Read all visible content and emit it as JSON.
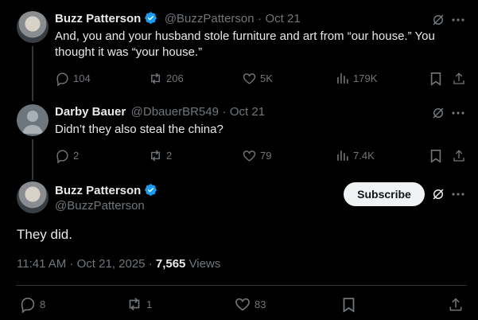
{
  "tweets": [
    {
      "name": "Buzz Patterson",
      "handle": "@BuzzPatterson",
      "sep": "·",
      "date": "Oct 21",
      "text": "And, you and your husband stole furniture and art from “our house.” You thought it was “your house.”",
      "replies": "104",
      "retweets": "206",
      "likes": "5K",
      "views": "179K"
    },
    {
      "name": "Darby Bauer",
      "handle": "@DbauerBR549",
      "sep": "·",
      "date": "Oct 21",
      "text": "Didn’t they also steal the china?",
      "replies": "2",
      "retweets": "2",
      "likes": "79",
      "views": "7.4K"
    }
  ],
  "main": {
    "name": "Buzz Patterson",
    "handle": "@BuzzPatterson",
    "subscribe_label": "Subscribe",
    "text": "They did.",
    "time": "11:41 AM",
    "sep1": "·",
    "date": "Oct 21, 2025",
    "sep2": "·",
    "views_count": "7,565",
    "views_label": "Views",
    "replies": "8",
    "retweets": "1",
    "likes": "83"
  },
  "colors": {
    "background": "#000000",
    "text": "#e7e9ea",
    "muted": "#71767b",
    "verified": "#1d9bf0",
    "subscribe_bg": "#eff3f4"
  }
}
